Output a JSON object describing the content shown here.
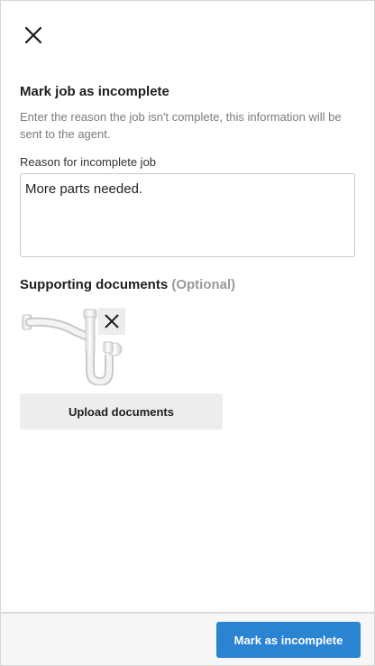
{
  "header": {
    "close_icon": "close-icon"
  },
  "form": {
    "heading": "Mark job as incomplete",
    "description": "Enter the reason the job isn't complete, this information will be sent to the agent.",
    "reason_label": "Reason for incomplete job",
    "reason_value": "More parts needed."
  },
  "documents": {
    "title": "Supporting documents",
    "optional": "(Optional)",
    "items": [
      {
        "thumbnail": "pipe-trap-image",
        "remove_icon": "close-icon"
      }
    ],
    "upload_label": "Upload documents"
  },
  "footer": {
    "submit_label": "Mark as incomplete",
    "accent_color": "#2b84d2"
  }
}
